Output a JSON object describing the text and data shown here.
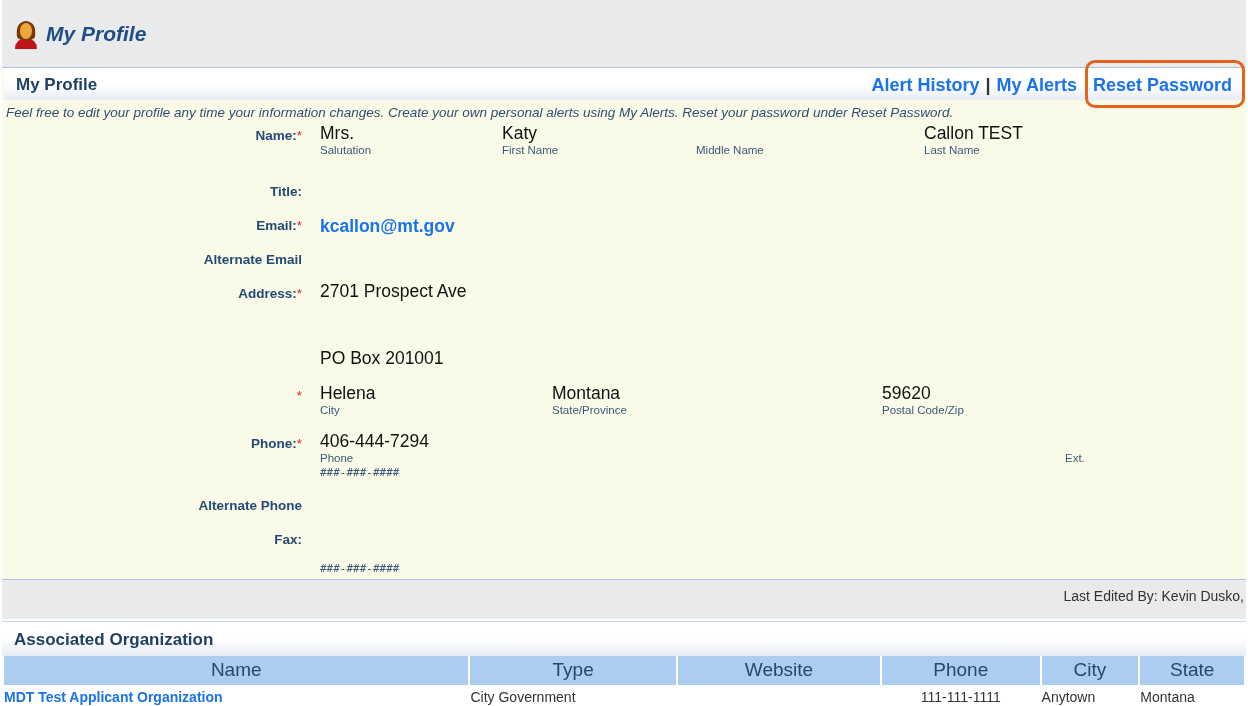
{
  "header": {
    "title": "My Profile"
  },
  "panel": {
    "title": "My Profile",
    "links": [
      {
        "label": "Alert History",
        "highlighted": false
      },
      {
        "label": "My Alerts",
        "highlighted": false
      },
      {
        "label": "Reset Password",
        "highlighted": true
      }
    ],
    "separator": "|",
    "intro": "Feel free to edit your profile any time your information changes. Create your own personal alerts using My Alerts. Reset your password under Reset Password."
  },
  "form": [
    {
      "kind": "name",
      "label": "Name:",
      "required": true,
      "parts": [
        {
          "value": "Mrs.",
          "caption": "Salutation"
        },
        {
          "value": "Katy",
          "caption": "First Name"
        },
        {
          "caption": "Middle Name"
        },
        {
          "value": "Callon TEST",
          "caption": "Last Name"
        }
      ]
    },
    {
      "kind": "empty",
      "label": "Title:",
      "required": false
    },
    {
      "kind": "email",
      "label": "Email:",
      "required": true,
      "value": "kcallon@mt.gov"
    },
    {
      "kind": "empty",
      "label": "Alternate Email",
      "required": false
    },
    {
      "kind": "address",
      "label": "Address:",
      "required": true,
      "lines": [
        "2701 Prospect Ave",
        "PO Box 201001"
      ]
    },
    {
      "kind": "city",
      "required": true,
      "parts": [
        {
          "value": "Helena",
          "caption": "City"
        },
        {
          "value": "Montana",
          "caption": "State/Province"
        },
        {
          "value": "59620",
          "caption": "Postal Code/Zip"
        }
      ]
    },
    {
      "kind": "phone",
      "label": "Phone:",
      "required": true,
      "value": "406-444-7294",
      "caption": "Phone",
      "mask": "###-###-####",
      "ext": "Ext."
    },
    {
      "kind": "empty",
      "label": "Alternate Phone",
      "required": false
    },
    {
      "kind": "fax",
      "label": "Fax:",
      "required": false,
      "mask": "###-###-####"
    }
  ],
  "required_mark": "*",
  "last_edited": "Last Edited By: Kevin Dusko,",
  "organizations": {
    "title": "Associated Organization",
    "columns": [
      "Name",
      "Type",
      "Website",
      "Phone",
      "City",
      "State"
    ],
    "rows": [
      [
        "MDT Test Applicant Organization",
        "City Government",
        "",
        "111-111-1111",
        "Anytown",
        "Montana"
      ]
    ]
  }
}
